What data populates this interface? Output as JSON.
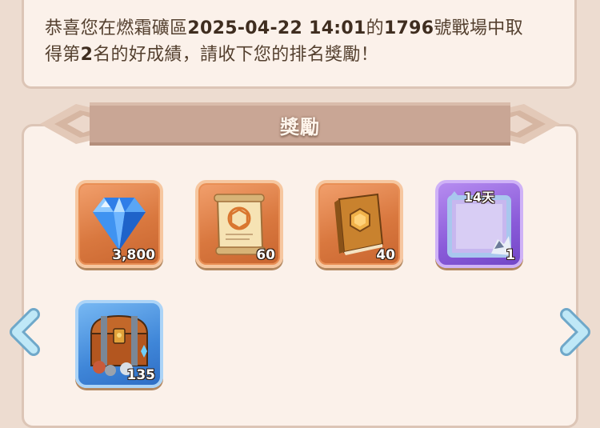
{
  "message": {
    "p1": "恭喜您在燃霜礦區",
    "datetime": "2025-04-22 14:01",
    "p2": "的",
    "battle_id": "1796",
    "p3": "號戰場中取",
    "p4": "得第",
    "rank": "2",
    "p5": "名的好成績，請收下您的排名獎勵！"
  },
  "rewards": {
    "title": "獎勵",
    "items": [
      {
        "icon": "diamond-icon",
        "count": "3,800",
        "frame_color": "#d9783f"
      },
      {
        "icon": "scroll-icon",
        "count": "60",
        "frame_color": "#d9783f"
      },
      {
        "icon": "book-icon",
        "count": "40",
        "frame_color": "#d9783f"
      },
      {
        "icon": "avatar-frame-icon",
        "count": "1",
        "duration": "14天",
        "frame_color": "#8a5bd9"
      },
      {
        "icon": "treasure-chest-icon",
        "count": "135",
        "frame_color": "#3f86d8"
      }
    ]
  },
  "nav": {
    "left_icon": "chevron-left-icon",
    "right_icon": "chevron-right-icon",
    "color": "#9fd6ef"
  }
}
